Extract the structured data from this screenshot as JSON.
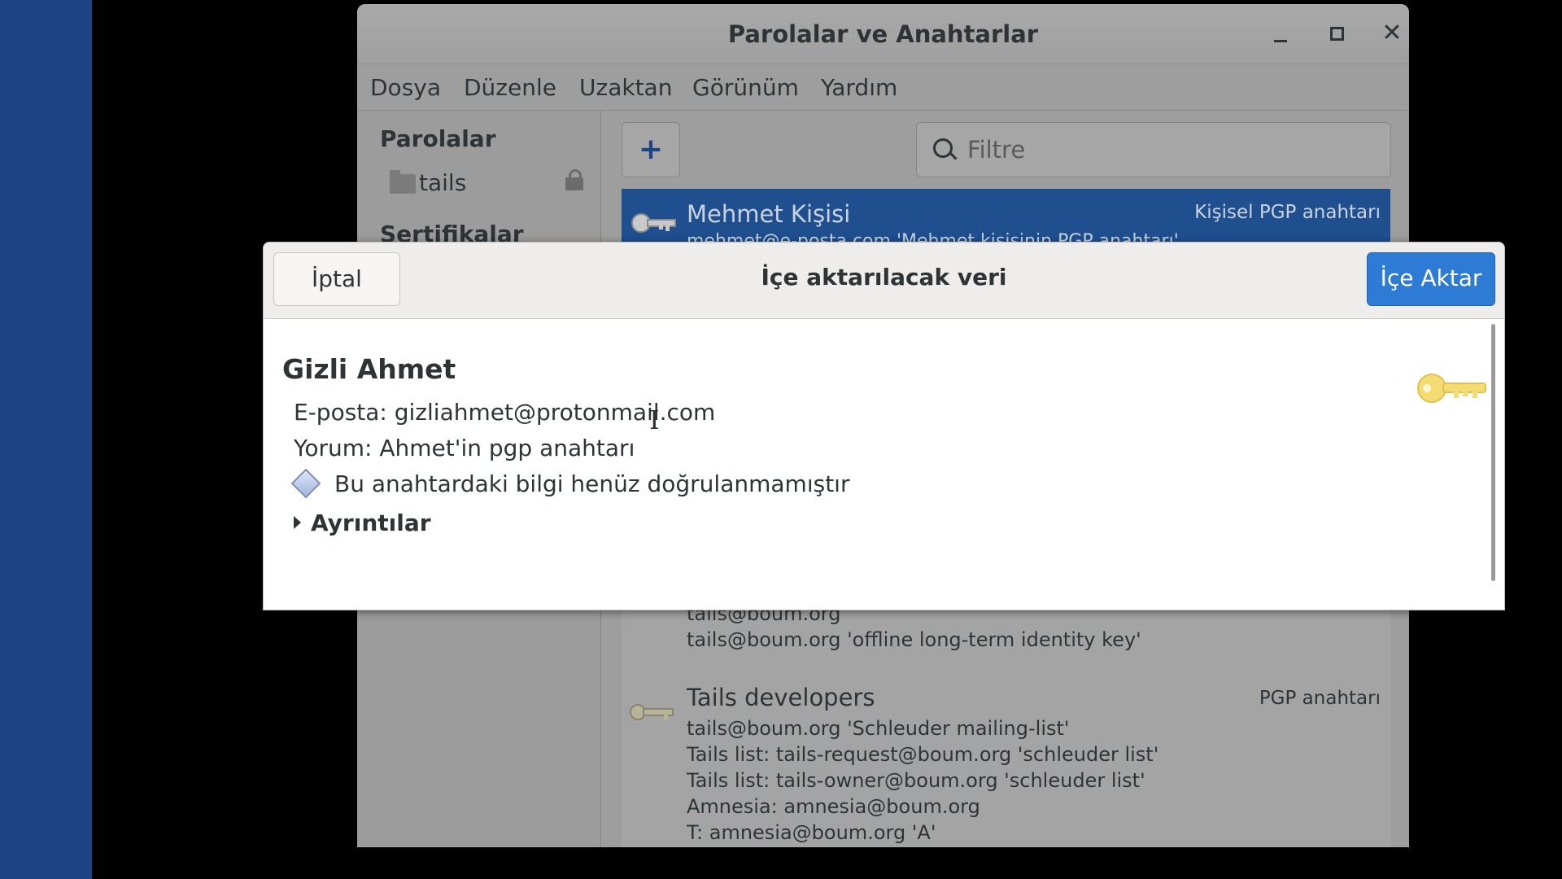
{
  "window": {
    "title": "Parolalar ve Anahtarlar",
    "controls": {
      "minimize": "minimize-icon",
      "maximize": "maximize-icon",
      "close": "close-icon"
    }
  },
  "menu": [
    "Dosya",
    "Düzenle",
    "Uzaktan",
    "Görünüm",
    "Yardım"
  ],
  "sidebar": {
    "passwords_heading": "Parolalar",
    "keyring": "tails",
    "certificates_heading": "Sertifikalar"
  },
  "toolbar": {
    "add_label": "+",
    "filter_placeholder": "Filtre"
  },
  "list": {
    "selected": {
      "name": "Mehmet Kişisi",
      "type": "Kişisel PGP anahtarı",
      "subtitle": "mehmet@e-posta.com 'Mehmet kişisinin PGP anahtarı'"
    },
    "partial_lines": [
      "tails@boum.org",
      "tails@boum.org 'offline long-term identity key'"
    ],
    "developers": {
      "name": "Tails developers",
      "type": "PGP anahtarı",
      "lines": [
        "tails@boum.org 'Schleuder mailing-list'",
        "Tails list: tails-request@boum.org 'schleuder list'",
        "Tails list: tails-owner@boum.org 'schleuder list'",
        "Amnesia: amnesia@boum.org",
        "T: amnesia@boum.org 'A'"
      ]
    }
  },
  "dialog": {
    "cancel": "İptal",
    "title": "İçe aktarılacak veri",
    "import": "İçe Aktar",
    "key_name": "Gizli Ahmet",
    "email": "E-posta: gizliahmet@protonmail.com",
    "comment": "Yorum: Ahmet'in pgp anahtarı",
    "warning": "Bu anahtardaki bilgi henüz doğrulanmamıştır",
    "details": "Ayrıntılar"
  },
  "colors": {
    "accent": "#2e7bd6",
    "selection": "#1f4f8f",
    "desktop": "#1c4485"
  }
}
